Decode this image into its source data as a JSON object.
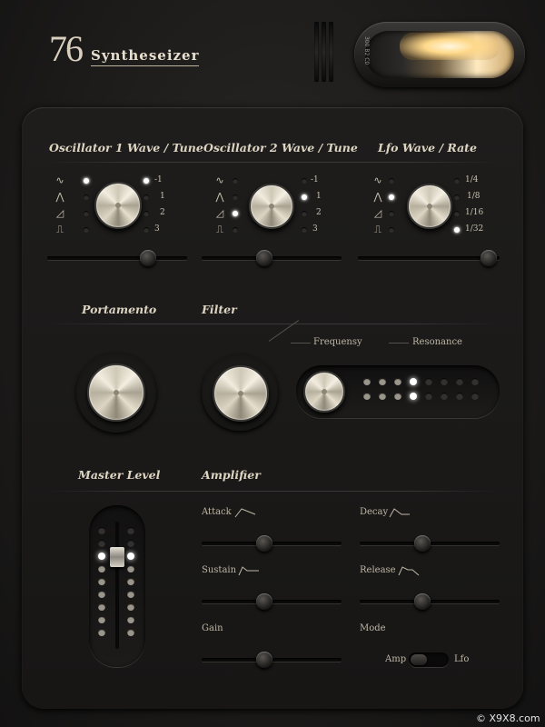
{
  "header": {
    "logo_number": "76",
    "logo_name": "Syntheseizer",
    "tube_label": "300 B2 C0"
  },
  "oscillator1": {
    "title": "Oscillator 1 Wave / Tune",
    "tune_values": [
      "-1",
      "1",
      "2",
      "3"
    ],
    "slider_value": 0.72
  },
  "oscillator2": {
    "title": "Oscillator 2 Wave / Tune",
    "tune_values": [
      "-1",
      "1",
      "2",
      "3"
    ],
    "slider_value": 0.45
  },
  "lfo": {
    "title": "Lfo Wave / Rate",
    "rate_values": [
      "1/4",
      "1/8",
      "1/16",
      "1/32"
    ],
    "slider_value": 0.92
  },
  "wave_icons": [
    "∿",
    "⋀",
    "◿",
    "⎍"
  ],
  "portamento": {
    "title": "Portamento"
  },
  "filter": {
    "title": "Filter",
    "frequency_label": "Frequensy",
    "resonance_label": "Resonance"
  },
  "master": {
    "title": "Master Level"
  },
  "amplifier": {
    "title": "Amplifier",
    "attack_label": "Attack",
    "attack_value": 0.45,
    "decay_label": "Decay",
    "decay_value": 0.45,
    "sustain_label": "Sustain",
    "sustain_value": 0.45,
    "release_label": "Release",
    "release_value": 0.45,
    "gain_label": "Gain",
    "gain_value": 0.45,
    "mode_label": "Mode",
    "mode_left": "Amp",
    "mode_right": "Lfo"
  },
  "watermark": "© X9X8.com",
  "colors": {
    "led_on": "#ffffff",
    "accent": "#d8cfbd",
    "background": "#1c1b1a"
  }
}
